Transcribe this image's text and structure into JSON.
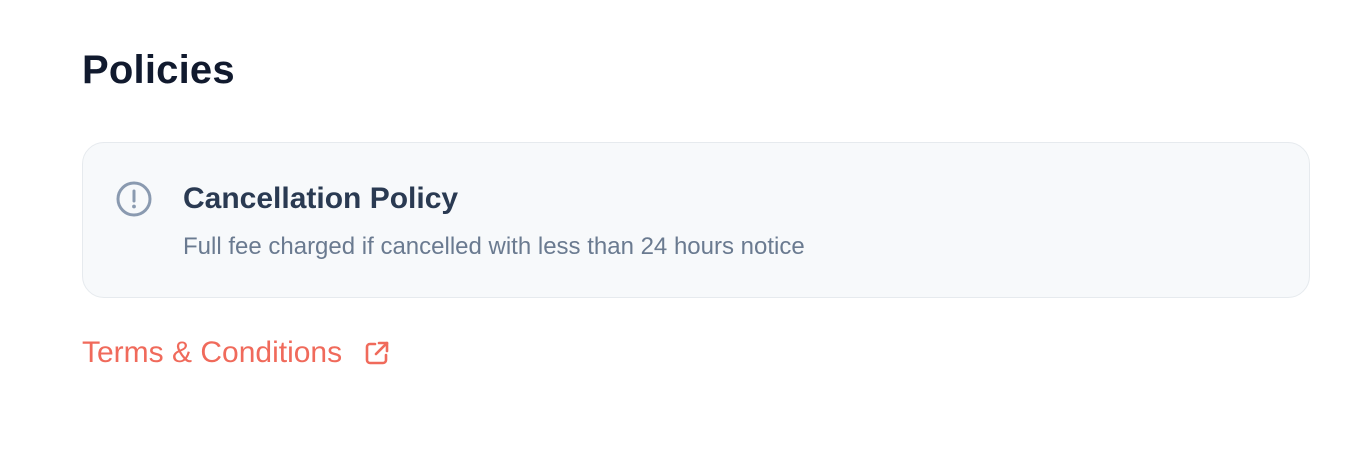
{
  "policies": {
    "title": "Policies",
    "cancellation": {
      "icon": "alert-circle-icon",
      "title": "Cancellation Policy",
      "description": "Full fee charged if cancelled with less than 24 hours notice"
    },
    "terms_link": {
      "label": "Terms & Conditions",
      "icon": "external-link-icon"
    }
  },
  "colors": {
    "heading": "#111a2e",
    "card_background": "#f7f9fb",
    "card_title": "#2a3a52",
    "muted_text": "#6a7a90",
    "icon": "#8a9ab0",
    "link_accent": "#f06a5b"
  }
}
